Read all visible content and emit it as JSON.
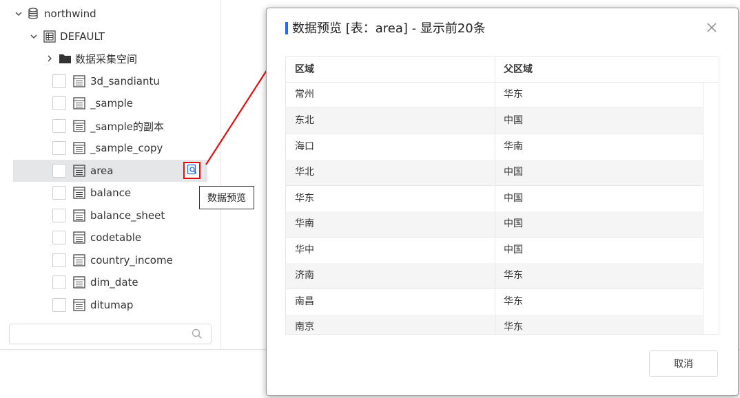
{
  "tree": {
    "db_name": "northwind",
    "schema_name": "DEFAULT",
    "folder_name": "数据采集空间",
    "tables": [
      "3d_sandiantu",
      "_sample",
      "_sample的副本",
      "_sample_copy",
      "area",
      "balance",
      "balance_sheet",
      "codetable",
      "country_income",
      "dim_date",
      "ditumap"
    ],
    "selected_table": "area",
    "preview_tooltip": "数据预览",
    "search_placeholder": ""
  },
  "dialog": {
    "title": "数据预览  [表：area] - 显示前20条",
    "columns": [
      "区域",
      "父区域"
    ],
    "rows": [
      [
        "常州",
        "华东"
      ],
      [
        "东北",
        "中国"
      ],
      [
        "海口",
        "华南"
      ],
      [
        "华北",
        "中国"
      ],
      [
        "华东",
        "中国"
      ],
      [
        "华南",
        "中国"
      ],
      [
        "华中",
        "中国"
      ],
      [
        "济南",
        "华东"
      ],
      [
        "南昌",
        "华东"
      ],
      [
        "南京",
        "华东"
      ]
    ],
    "cancel_label": "取消"
  },
  "colors": {
    "accent": "#1f6cf0",
    "highlight": "#e01010",
    "selected_row": "#e5e6e8",
    "alt_row": "#f5f5f5"
  },
  "icons": [
    "chevron-down-icon",
    "chevron-right-icon",
    "database-icon",
    "schema-icon",
    "folder-icon",
    "table-icon",
    "preview-icon",
    "search-icon",
    "close-icon"
  ]
}
